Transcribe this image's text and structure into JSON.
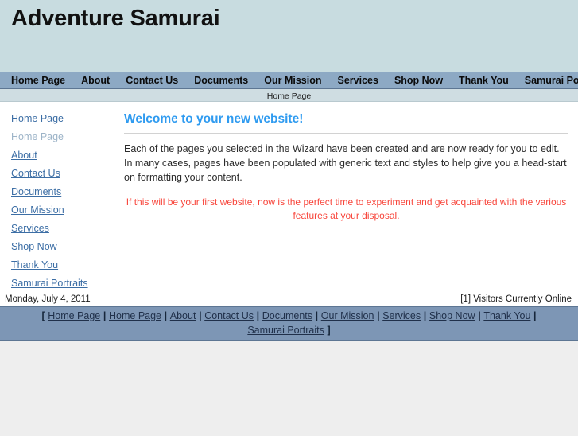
{
  "header": {
    "site_title": "Adventure Samurai",
    "background_color": "#c8dce0"
  },
  "topnav": {
    "background_color": "#8da9c4",
    "items": [
      {
        "label": "Home Page"
      },
      {
        "label": "About"
      },
      {
        "label": "Contact Us"
      },
      {
        "label": "Documents"
      },
      {
        "label": "Our Mission"
      },
      {
        "label": "Services"
      },
      {
        "label": "Shop Now"
      },
      {
        "label": "Thank You"
      },
      {
        "label": "Samurai Portraits"
      }
    ]
  },
  "breadcrumb": {
    "text": "Home Page"
  },
  "sidebar": {
    "items": [
      {
        "label": "Home Page",
        "state": "link"
      },
      {
        "label": "Home Page",
        "state": "current"
      },
      {
        "label": "About",
        "state": "link"
      },
      {
        "label": "Contact Us",
        "state": "link"
      },
      {
        "label": "Documents",
        "state": "link"
      },
      {
        "label": "Our Mission",
        "state": "link"
      },
      {
        "label": "Services",
        "state": "link"
      },
      {
        "label": "Shop Now",
        "state": "link"
      },
      {
        "label": "Thank You",
        "state": "link"
      },
      {
        "label": "Samurai Portraits",
        "state": "link"
      }
    ]
  },
  "content": {
    "heading": "Welcome to your new website!",
    "heading_color": "#2f9bf0",
    "paragraph": "Each of the pages you selected in the Wizard have been created and are now ready for you to edit. In many cases, pages have been populated with generic text and styles to help give you a head-start on formatting your content.",
    "note": "If this will be your first website, now is the perfect time to experiment and get acquainted with the various features at your disposal.",
    "note_color": "#f8463c"
  },
  "footer": {
    "date": "Monday, July 4, 2011",
    "visitors": "[1] Visitors Currently Online",
    "open_bracket": "[",
    "close_bracket": "]",
    "separator": "|",
    "background_color": "#7d96b5",
    "links": [
      {
        "label": "Home Page"
      },
      {
        "label": "Home Page"
      },
      {
        "label": "About"
      },
      {
        "label": "Contact Us"
      },
      {
        "label": "Documents"
      },
      {
        "label": "Our Mission"
      },
      {
        "label": "Services"
      },
      {
        "label": "Shop Now"
      },
      {
        "label": "Thank You"
      },
      {
        "label": "Samurai Portraits"
      }
    ]
  }
}
